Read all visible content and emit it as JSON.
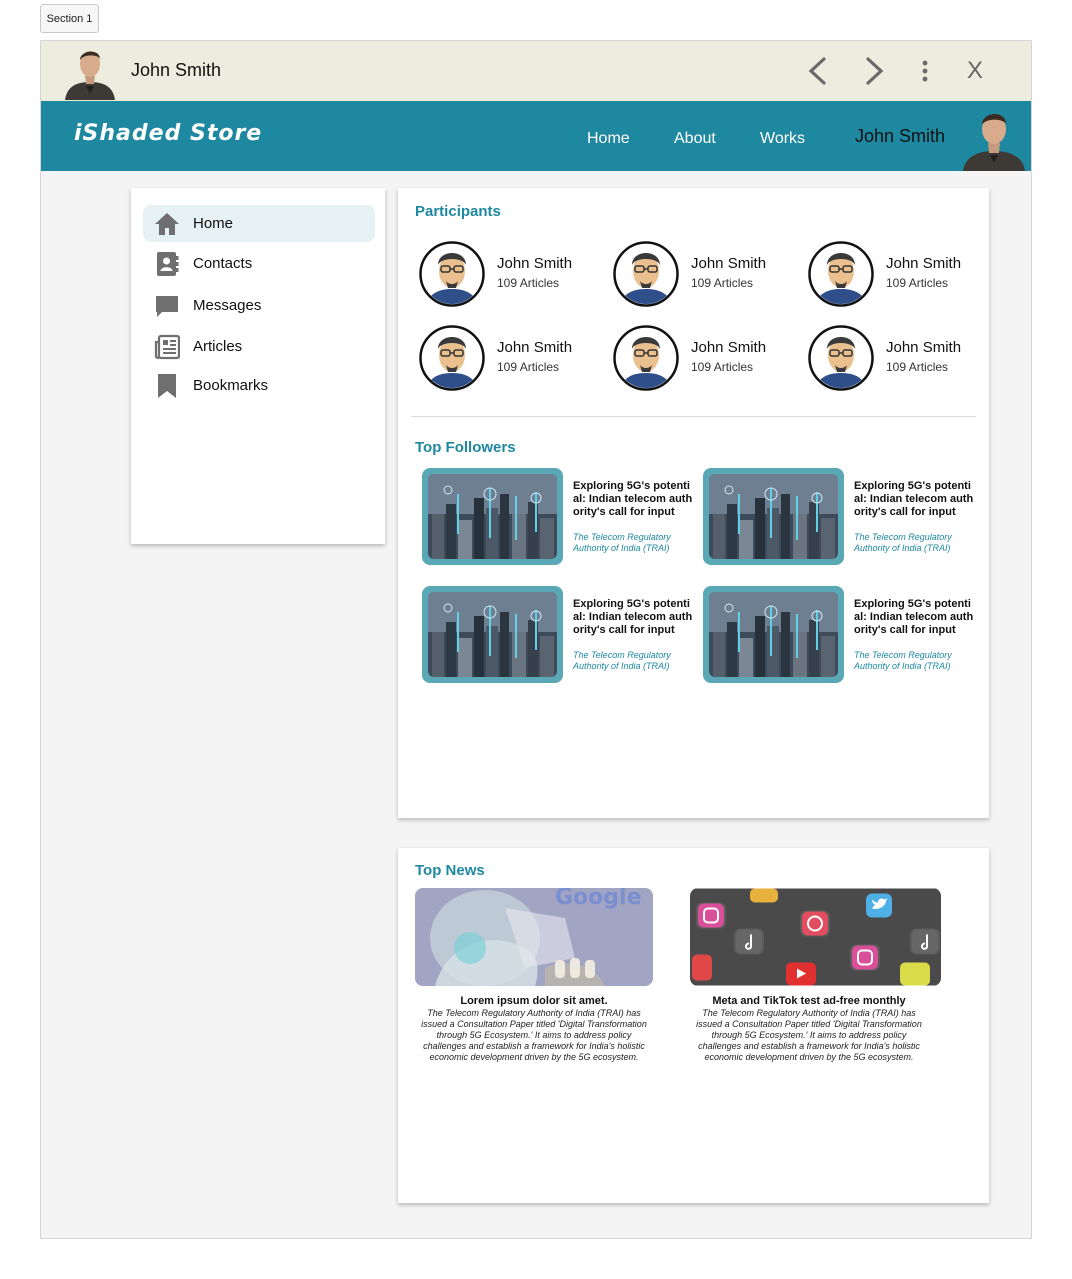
{
  "section_tag": "Section 1",
  "titlebar": {
    "user_name": "John Smith",
    "close_label": "X"
  },
  "navbar": {
    "brand": "iShaded Store",
    "links": [
      "Home",
      "About",
      "Works"
    ],
    "user_name": "John Smith"
  },
  "sidebar": {
    "items": [
      {
        "label": "Home",
        "icon": "home-icon",
        "active": true
      },
      {
        "label": "Contacts",
        "icon": "contacts-icon"
      },
      {
        "label": "Messages",
        "icon": "message-icon"
      },
      {
        "label": "Articles",
        "icon": "newspaper-icon"
      },
      {
        "label": "Bookmarks",
        "icon": "bookmark-icon"
      }
    ]
  },
  "participants": {
    "title": "Participants",
    "items": [
      {
        "name": "John Smith",
        "articles": "109 Articles"
      },
      {
        "name": "John Smith",
        "articles": "109 Articles"
      },
      {
        "name": "John Smith",
        "articles": "109 Articles"
      },
      {
        "name": "John Smith",
        "articles": "109 Articles"
      },
      {
        "name": "John Smith",
        "articles": "109 Articles"
      },
      {
        "name": "John Smith",
        "articles": "109 Articles"
      }
    ]
  },
  "followers": {
    "title": "Top Followers",
    "items": [
      {
        "headline": "Exploring 5G's potential: Indian telecom authority's call for input",
        "source": "The Telecom Regulatory Authority of India (TRAI)"
      },
      {
        "headline": "Exploring 5G's potential: Indian telecom authority's call for input",
        "source": "The Telecom Regulatory Authority of India (TRAI)"
      },
      {
        "headline": "Exploring 5G's potential: Indian telecom authority's call for input",
        "source": "The Telecom Regulatory Authority of India (TRAI)"
      },
      {
        "headline": "Exploring 5G's potential: Indian telecom authority's call for input",
        "source": "The Telecom Regulatory Authority of India (TRAI)"
      }
    ]
  },
  "news": {
    "title": "Top News",
    "items": [
      {
        "headline": "Lorem ipsum dolor sit amet.",
        "body": "The Telecom Regulatory Authority of India (TRAI) has issued a Consultation Paper titled 'Digital Transformation through 5G Ecosystem.' It aims to address policy challenges and establish a framework for India's holistic economic development driven by the 5G ecosystem.",
        "image_text": "Google"
      },
      {
        "headline": "Meta and TikTok test ad-free monthly",
        "body": "The Telecom Regulatory Authority of India (TRAI) has issued a Consultation Paper titled 'Digital Transformation through 5G Ecosystem.' It aims to address policy challenges and establish a framework for India's holistic economic development driven by the 5G ecosystem."
      }
    ]
  },
  "colors": {
    "accent": "#1f88a1",
    "titlebar_bg": "#ededdf",
    "thumb_frame": "#5aa7b5"
  }
}
